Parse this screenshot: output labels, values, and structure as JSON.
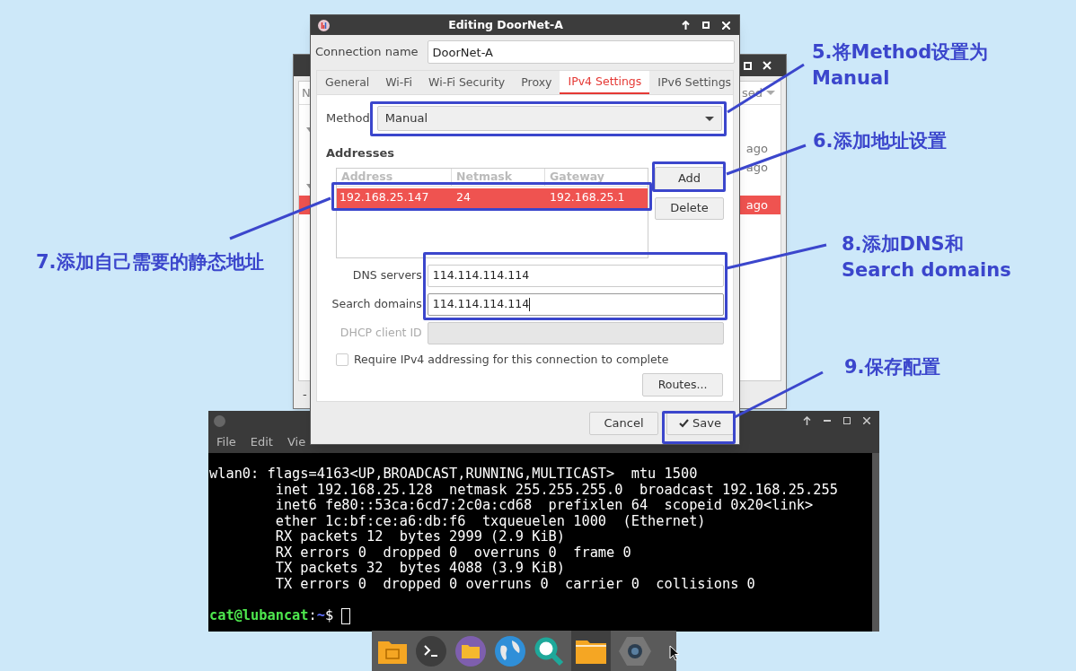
{
  "background_window": {
    "column_headers": [
      "N",
      "sed"
    ],
    "rows": [
      {
        "kind": "group"
      },
      {
        "kind": "item",
        "time": "ago",
        "selected": false
      },
      {
        "kind": "item",
        "time": "ago",
        "selected": false
      },
      {
        "kind": "group"
      },
      {
        "kind": "item",
        "time": "ago",
        "selected": true
      }
    ],
    "footer_button": "-"
  },
  "dialog": {
    "title": "Editing DoorNet-A",
    "connection_name_label": "Connection name",
    "connection_name": "DoorNet-A",
    "tabs": [
      {
        "label": "General",
        "selected": false
      },
      {
        "label": "Wi-Fi",
        "selected": false
      },
      {
        "label": "Wi-Fi Security",
        "selected": false
      },
      {
        "label": "Proxy",
        "selected": false
      },
      {
        "label": "IPv4 Settings",
        "selected": true
      },
      {
        "label": "IPv6 Settings",
        "selected": false
      }
    ],
    "method_label": "Method",
    "method": "Manual",
    "addresses_heading": "Addresses",
    "address_columns": [
      "Address",
      "Netmask",
      "Gateway"
    ],
    "address_rows": [
      {
        "cells": [
          "192.168.25.147",
          "24",
          "192.168.25.1"
        ],
        "selected": true
      }
    ],
    "add_button": "Add",
    "delete_button": "Delete",
    "fields": [
      {
        "label": "DNS servers",
        "value": "114.114.114.114",
        "disabled": false,
        "focused": false
      },
      {
        "label": "Search domains",
        "value": "114.114.114.114",
        "disabled": false,
        "focused": true
      },
      {
        "label": "DHCP client ID",
        "disabled": true,
        "focused": false
      }
    ],
    "require_checkbox": {
      "label": "Require IPv4 addressing for this connection to complete",
      "checked": false
    },
    "routes_button": "Routes...",
    "cancel_button": "Cancel",
    "save_button": "Save"
  },
  "terminal": {
    "menu": [
      "File",
      "Edit",
      "Vie"
    ],
    "output": [
      "wlan0: flags=4163<UP,BROADCAST,RUNNING,MULTICAST>  mtu 1500",
      "        inet 192.168.25.128  netmask 255.255.255.0  broadcast 192.168.25.255",
      "        inet6 fe80::53ca:6cd7:2c0a:cd68  prefixlen 64  scopeid 0x20<link>",
      "        ether 1c:bf:ce:a6:db:f6  txqueuelen 1000  (Ethernet)",
      "        RX packets 12  bytes 2999 (2.9 KiB)",
      "        RX errors 0  dropped 0  overruns 0  frame 0",
      "        TX packets 32  bytes 4088 (3.9 KiB)",
      "        TX errors 0  dropped 0 overruns 0  carrier 0  collisions 0"
    ],
    "prompt_user": "cat@lubancat",
    "prompt_colon": ":",
    "prompt_path": "~",
    "prompt_symbol": "$"
  },
  "annotations": [
    {
      "lines": [
        "5.将Method设置为",
        "Manual"
      ]
    },
    {
      "lines": [
        "6.添加地址设置"
      ]
    },
    {
      "lines": [
        "7.添加自己需要的静态地址"
      ]
    },
    {
      "lines": [
        "8.添加DNS和",
        "Search domains"
      ]
    },
    {
      "lines": [
        "9.保存配置"
      ]
    }
  ]
}
